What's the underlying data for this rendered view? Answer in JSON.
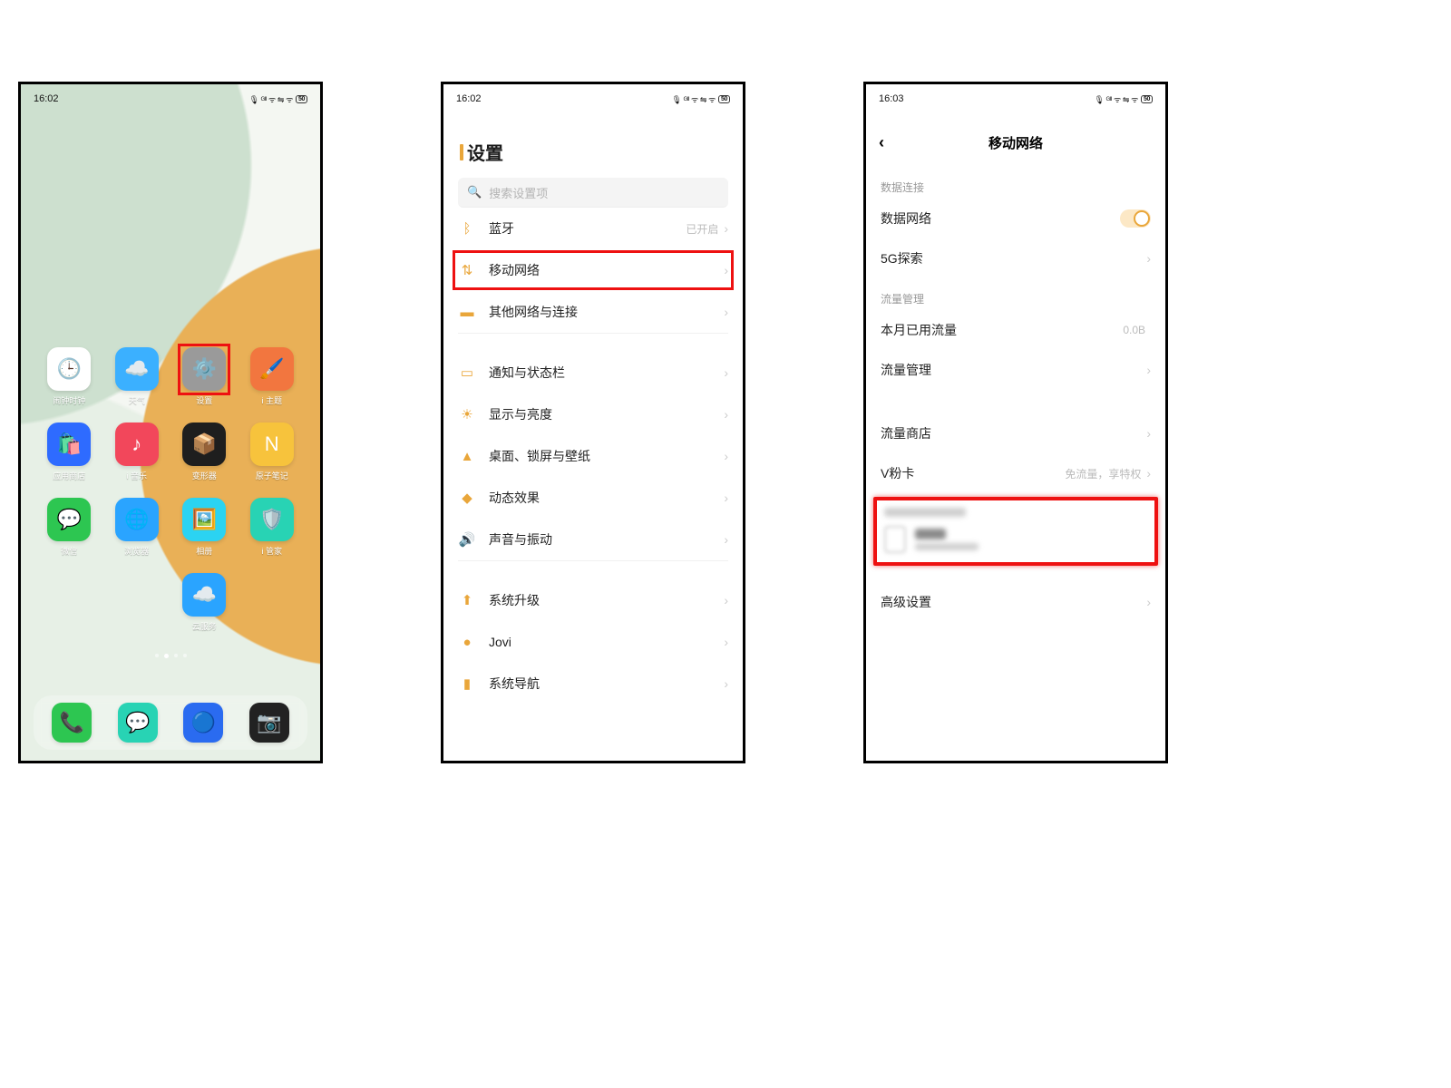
{
  "status": {
    "time1": "16:02",
    "time2": "16:02",
    "time3": "16:03",
    "indicators": "🎙 ᴳᴵᴵ ᯤ ⇋ ᯤ",
    "battery": "50"
  },
  "screen1": {
    "apps": [
      {
        "label": "闹钟时钟",
        "bg": "#fff",
        "emoji": "🕒",
        "fg": "#555"
      },
      {
        "label": "天气",
        "bg": "#3bb0ff",
        "emoji": "☁️"
      },
      {
        "label": "设置",
        "bg": "#9a9a9a",
        "emoji": "⚙️",
        "hilite": true
      },
      {
        "label": "i 主题",
        "bg": "#f2763f",
        "emoji": "🖌️"
      },
      {
        "label": "应用商店",
        "bg": "#2e6bff",
        "emoji": "🛍️"
      },
      {
        "label": "i 音乐",
        "bg": "#f2475b",
        "emoji": "♪"
      },
      {
        "label": "变形器",
        "bg": "#1e1e1e",
        "emoji": "📦"
      },
      {
        "label": "原子笔记",
        "bg": "#f7c33c",
        "emoji": "N",
        "fg": "#fff"
      },
      {
        "label": "微信",
        "bg": "#2dc651",
        "emoji": "💬"
      },
      {
        "label": "浏览器",
        "bg": "#2aa4ff",
        "emoji": "🌐"
      },
      {
        "label": "相册",
        "bg": "#2bd3f2",
        "emoji": "🖼️"
      },
      {
        "label": "i 管家",
        "bg": "#28d3b4",
        "emoji": "🛡️"
      },
      {
        "label": "云服务",
        "bg": "#2aa4ff",
        "emoji": "☁️",
        "col": 3
      }
    ],
    "dock": [
      {
        "bg": "#2dc651",
        "emoji": "📞",
        "name": "phone"
      },
      {
        "bg": "#28d3b4",
        "emoji": "💬",
        "name": "messages"
      },
      {
        "bg": "#2a6bf0",
        "emoji": "🔵",
        "name": "browser"
      },
      {
        "bg": "#222",
        "emoji": "📷",
        "name": "camera"
      }
    ]
  },
  "screen2": {
    "title": "设置",
    "searchPh": "搜索设置项",
    "groups": [
      [
        {
          "icon": "ᛒ",
          "label": "蓝牙",
          "value": "已开启"
        },
        {
          "icon": "⇅",
          "label": "移动网络",
          "hilite": true
        },
        {
          "icon": "▬",
          "label": "其他网络与连接"
        }
      ],
      [
        {
          "icon": "▭",
          "label": "通知与状态栏"
        },
        {
          "icon": "☀",
          "label": "显示与亮度"
        },
        {
          "icon": "▲",
          "label": "桌面、锁屏与壁纸"
        },
        {
          "icon": "◆",
          "label": "动态效果"
        },
        {
          "icon": "🔊",
          "label": "声音与振动"
        }
      ],
      [
        {
          "icon": "⬆",
          "label": "系统升级"
        },
        {
          "icon": "●",
          "label": "Jovi"
        },
        {
          "icon": "▮",
          "label": "系统导航"
        }
      ]
    ]
  },
  "screen3": {
    "title": "移动网络",
    "sections": [
      {
        "label": "数据连接",
        "rows": [
          {
            "label": "数据网络",
            "toggle": true
          },
          {
            "label": "5G探索",
            "chev": true
          }
        ]
      },
      {
        "label": "流量管理",
        "rows": [
          {
            "label": "本月已用流量",
            "value": "0.0B"
          },
          {
            "label": "流量管理",
            "chev": true
          }
        ]
      },
      {
        "label": "",
        "rows": [
          {
            "label": "流量商店",
            "chev": true
          },
          {
            "label": "V粉卡",
            "value": "免流量，享特权",
            "chev": true
          }
        ]
      }
    ],
    "advanced": "高级设置"
  }
}
